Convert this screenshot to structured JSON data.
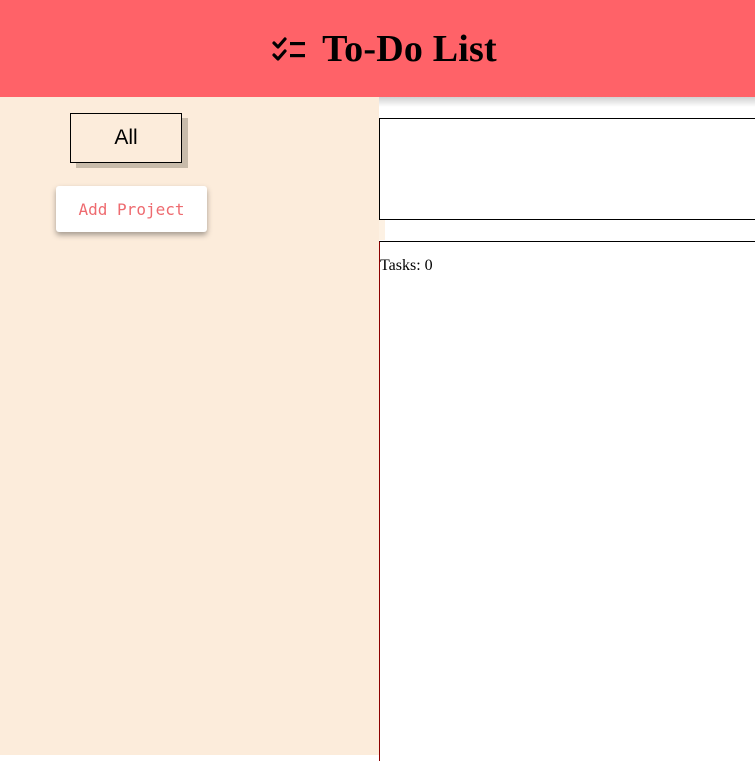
{
  "header": {
    "title": "To-Do List",
    "icon": "checklist-icon",
    "background_color": "#ff6268"
  },
  "sidebar": {
    "background_color": "#fcecdb",
    "all_label": "All",
    "add_project_label": "Add Project",
    "add_project_color": "#ee6b70"
  },
  "main": {
    "tasks_label": "Tasks:",
    "tasks_count": "0"
  }
}
